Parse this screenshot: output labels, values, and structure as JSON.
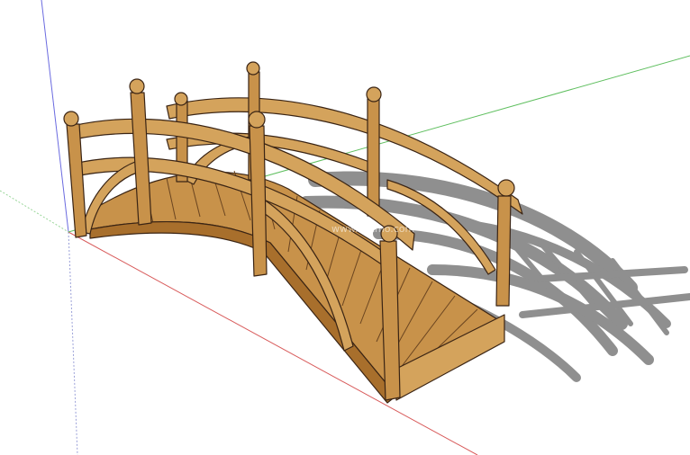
{
  "viewport": {
    "background": "#ffffff",
    "axis_colors": {
      "x_axis": "#d85b5b",
      "y_axis": "#5fbf5f",
      "z_axis": "#6a6ae0"
    },
    "watermark_text": "www.znzmo.com"
  },
  "model": {
    "wood_color": "#d4a35c",
    "wood_dark": "#a86f2c",
    "outline_color": "#3a2414",
    "shadow_color": "#8f8f8f"
  }
}
